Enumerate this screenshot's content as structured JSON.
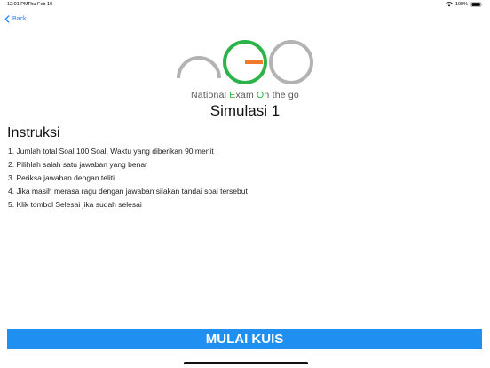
{
  "status_bar": {
    "time": "12:01 PM",
    "date": "Thu Feb 10",
    "battery": "100%",
    "icons": [
      "wifi-icon",
      "battery-icon"
    ]
  },
  "nav": {
    "back_label": "Back",
    "back_icon": "chevron-left-icon"
  },
  "logo": {
    "tagline_parts": [
      "National ",
      "E",
      "xam ",
      "O",
      "n the go"
    ],
    "colors": {
      "gray": "#b3b3b3",
      "green": "#2db34a",
      "orange": "#f07a2a"
    }
  },
  "page_title": "Simulasi 1",
  "section_title": "Instruksi",
  "instructions": [
    "1. Jumlah total Soal 100 Soal, Waktu yang diberikan 90 menit",
    "2. Pilihlah salah satu jawaban yang benar",
    "3. Periksa jawaban dengan teliti",
    "4. Jika masih merasa ragu dengan jawaban silakan tandai soal tersebut",
    "5. Klik tombol Selesai jika sudah selesai"
  ],
  "start_button_label": "MULAI KUIS",
  "colors": {
    "accent": "#1e80ff",
    "button": "#1f8ff2"
  }
}
